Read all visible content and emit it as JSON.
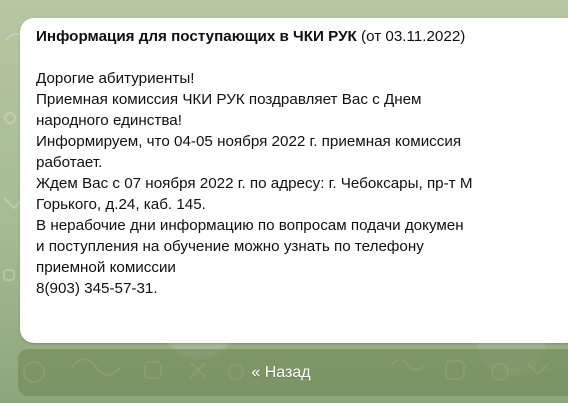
{
  "message": {
    "title_bold": "Информация для поступающих в ЧКИ РУК",
    "title_date": "(от 03.11.2022)",
    "lines": [
      "Дорогие абитуриенты!",
      "Приемная комиссия ЧКИ РУК поздравляет Вас с Днем",
      "народного единства!",
      "Информируем, что 04-05 ноября 2022 г. приемная комиссия",
      "работает.",
      "Ждем Вас с 07 ноября 2022 г. по адресу: г. Чебоксары, пр-т М",
      "Горького, д.24, каб. 145.",
      "В нерабочие дни информацию по вопросам подачи докумен",
      "и поступления на обучение можно узнать по телефону",
      "приемной комиссии",
      "8(903) 345-57-31."
    ],
    "time_fragment": "1"
  },
  "keyboard": {
    "back_label": "« Назад"
  },
  "colors": {
    "chat_background": "#a7bb93",
    "bubble": "#ffffff",
    "button": "#6e8754"
  }
}
